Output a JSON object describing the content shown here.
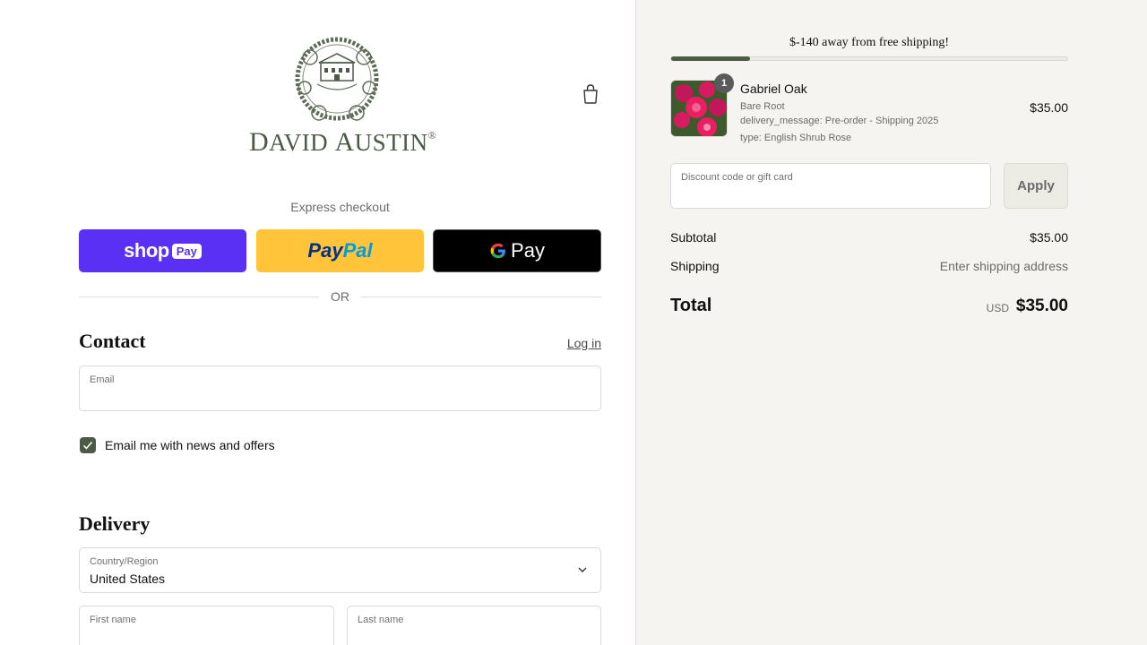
{
  "brand": {
    "logo_text_big_1": "D",
    "logo_text_small_1": "AVID ",
    "logo_text_big_2": "A",
    "logo_text_small_2": "USTIN",
    "logo_mark": "®"
  },
  "express": {
    "label": "Express checkout",
    "shop_pay_word": "shop",
    "shop_pay_tag": "Pay",
    "paypal_part1": "Pay",
    "paypal_part2": "Pal",
    "gpay_g": "G",
    "gpay_word": "Pay"
  },
  "or_text": "OR",
  "contact": {
    "title": "Contact",
    "login_link": "Log in",
    "email_label": "Email",
    "email_value": "",
    "newsletter_label": "Email me with news and offers",
    "newsletter_checked": true
  },
  "delivery": {
    "title": "Delivery",
    "country_label": "Country/Region",
    "country_value": "United States",
    "first_name_label": "First name",
    "last_name_label": "Last name"
  },
  "cart": {
    "shipping_message": "$-140 away from free shipping!",
    "free_shipping_progress": 0.2,
    "item": {
      "quantity": "1",
      "name": "Gabriel Oak",
      "variant": "Bare Root",
      "delivery_message": "delivery_message: Pre-order - Shipping 2025",
      "type": "type: English Shrub Rose",
      "price": "$35.00"
    },
    "discount_label": "Discount code or gift card",
    "apply_label": "Apply",
    "subtotal_label": "Subtotal",
    "subtotal_value": "$35.00",
    "shipping_label": "Shipping",
    "shipping_value": "Enter shipping address",
    "total_label": "Total",
    "total_currency": "USD",
    "total_value": "$35.00"
  },
  "colors": {
    "brand_green": "#4d5a45",
    "shop_pay": "#5a31f4",
    "paypal": "#ffc439",
    "gpay": "#000000",
    "summary_bg": "#f5f4f0"
  }
}
